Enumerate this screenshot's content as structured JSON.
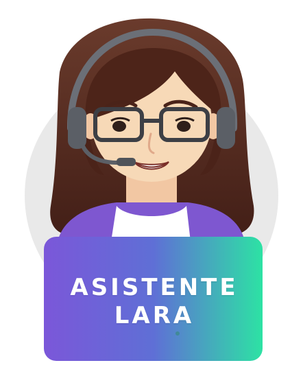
{
  "badge": {
    "line1": "ASISTENTE",
    "line2": "LARA"
  },
  "colors": {
    "background": "#ffffff",
    "circle": "#e8e8e8",
    "hair": "#4a2319",
    "skin": "#f7d9b7",
    "jacket": "#7e57d0",
    "headset": "#6b6f77",
    "sign_gradient_start": "#7b57d9",
    "sign_gradient_end": "#2de2a4"
  },
  "icons": {
    "avatar": "support-agent-illustration",
    "headset": "headset-icon"
  }
}
